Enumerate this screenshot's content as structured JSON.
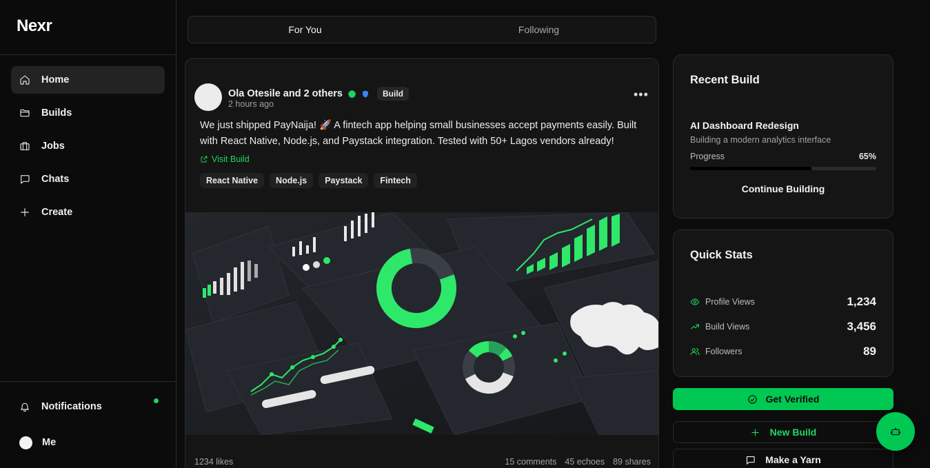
{
  "app": {
    "brand": "Nexr"
  },
  "sidebar": {
    "items": [
      {
        "label": "Home",
        "icon": "home-icon",
        "active": true
      },
      {
        "label": "Builds",
        "icon": "folder-icon"
      },
      {
        "label": "Jobs",
        "icon": "briefcase-icon"
      },
      {
        "label": "Chats",
        "icon": "message-icon"
      },
      {
        "label": "Create",
        "icon": "plus-icon"
      }
    ],
    "notifications_label": "Notifications",
    "me_label": "Me"
  },
  "feed_tabs": [
    {
      "label": "For You",
      "active": true
    },
    {
      "label": "Following",
      "active": false
    }
  ],
  "post": {
    "author": "Ola Otesile and 2 others",
    "type": "Build",
    "time": "2 hours ago",
    "text": "We just shipped PayNaija! 🚀 A fintech app helping small businesses accept payments easily. Built with React Native, Node.js, and Paystack integration. Tested with 50+ Lagos vendors already!",
    "link_label": "Visit Build",
    "tags": [
      "React Native",
      "Node.js",
      "Paystack",
      "Fintech"
    ],
    "likes": "1234 likes",
    "comments": "15 comments",
    "echoes": "45 echoes",
    "shares": "89 shares"
  },
  "recent_build": {
    "title": "Recent Build",
    "name": "AI Dashboard Redesign",
    "description": "Building a modern analytics interface",
    "progress_label": "Progress",
    "progress_text": "65%",
    "progress": 0.65,
    "continue_label": "Continue Building"
  },
  "quick_stats": {
    "title": "Quick Stats",
    "rows": [
      {
        "label": "Profile Views",
        "value": "1,234",
        "icon": "eye-icon"
      },
      {
        "label": "Build Views",
        "value": "3,456",
        "icon": "trending-up-icon"
      },
      {
        "label": "Followers",
        "value": "89",
        "icon": "users-icon"
      }
    ]
  },
  "actions": {
    "get_verified": "Get Verified",
    "new_build": "New Build",
    "make_yarn": "Make a Yarn"
  },
  "colors": {
    "accent": "#00c853",
    "background": "#0c0c0c",
    "card": "#151515"
  }
}
